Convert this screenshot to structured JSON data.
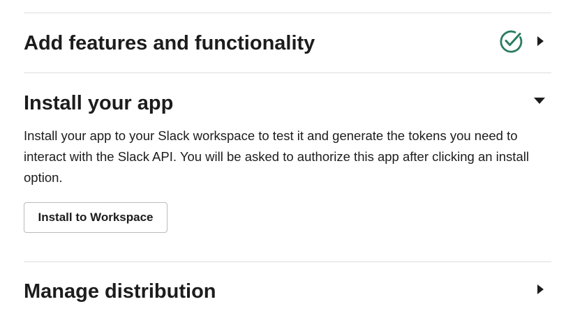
{
  "sections": {
    "features": {
      "title": "Add features and functionality",
      "status_icon": "check-circle-icon",
      "toggle_icon": "caret-right-icon"
    },
    "install": {
      "title": "Install your app",
      "toggle_icon": "caret-down-icon",
      "description": "Install your app to your Slack workspace to test it and generate the tokens you need to interact with the Slack API. You will be asked to authorize this app after clicking an install option.",
      "button_label": "Install to Workspace"
    },
    "distribution": {
      "title": "Manage distribution",
      "toggle_icon": "caret-right-icon"
    }
  },
  "colors": {
    "check_green": "#2a7d5f",
    "text": "#1d1c1d",
    "divider": "#dddddd"
  }
}
